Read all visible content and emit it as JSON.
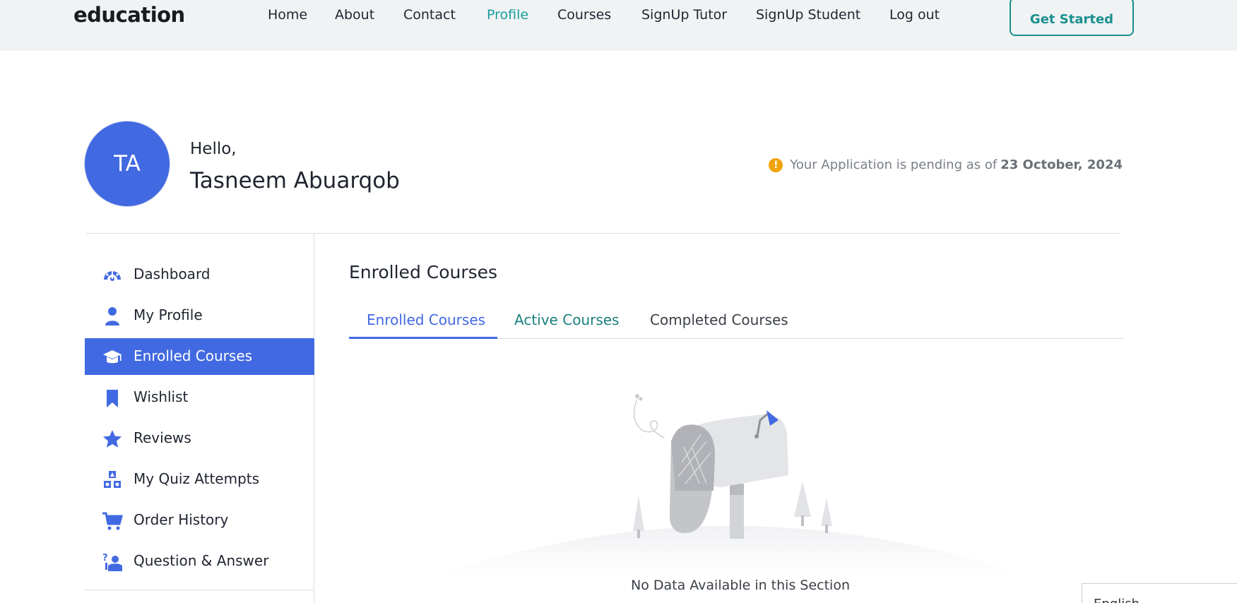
{
  "header": {
    "logo": "education",
    "nav": [
      {
        "label": "Home"
      },
      {
        "label": "About"
      },
      {
        "label": "Contact"
      },
      {
        "label": "Profile"
      },
      {
        "label": "Courses"
      },
      {
        "label": "SignUp Tutor"
      },
      {
        "label": "SignUp Student"
      },
      {
        "label": "Log out"
      }
    ],
    "active_nav": "Profile",
    "cta": "Get Started"
  },
  "profile": {
    "initials": "TA",
    "greeting": "Hello,",
    "name": "Tasneem Abuarqob",
    "pending_text": "Your Application is pending as of",
    "pending_date": "23 October, 2024"
  },
  "sidebar": {
    "items": [
      {
        "label": "Dashboard",
        "icon": "dashboard-gauge-icon"
      },
      {
        "label": "My Profile",
        "icon": "user-icon"
      },
      {
        "label": "Enrolled Courses",
        "icon": "graduation-cap-icon"
      },
      {
        "label": "Wishlist",
        "icon": "bookmark-icon"
      },
      {
        "label": "Reviews",
        "icon": "star-icon"
      },
      {
        "label": "My Quiz Attempts",
        "icon": "shapes-blocks-icon"
      },
      {
        "label": "Order History",
        "icon": "cart-icon"
      },
      {
        "label": "Question & Answer",
        "icon": "question-person-icon"
      }
    ],
    "active": "Enrolled Courses"
  },
  "main": {
    "title": "Enrolled Courses",
    "tabs": [
      {
        "label": "Enrolled Courses"
      },
      {
        "label": "Active Courses"
      },
      {
        "label": "Completed Courses"
      }
    ],
    "active_tab": "Enrolled Courses",
    "empty_message": "No Data Available in this Section",
    "empty_icon": "empty-mailbox-illustration"
  },
  "language": {
    "selected": "English"
  },
  "colors": {
    "accent": "#4169e1",
    "teal": "#1a8f8f",
    "warning": "#f0a30a"
  }
}
